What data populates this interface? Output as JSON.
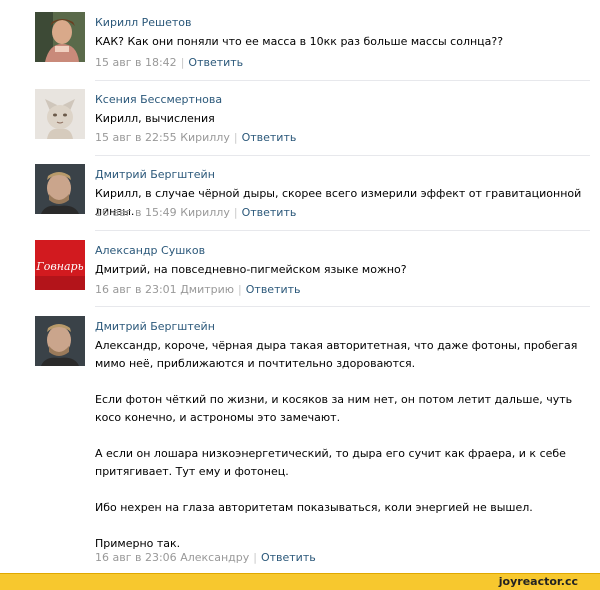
{
  "comments": [
    {
      "author": "Кирилл Решетов",
      "text": [
        "КАК? Как они поняли что ее масса в 10кк раз больше массы солнца??"
      ],
      "date": "15 авг в 18:42",
      "addressee": "",
      "reply": "Ответить"
    },
    {
      "author": "Ксения Бессмертнова",
      "text": [
        "Кирилл, вычисления"
      ],
      "date": "15 авг в 22:55",
      "addressee": "Кириллу",
      "reply": "Ответить"
    },
    {
      "author": "Дмитрий Бергштейн",
      "text": [
        "Кирилл, в случае чёрной дыры, скорее всего измерили эффект от гравитационной линзы."
      ],
      "date": "16 авг в 15:49",
      "addressee": "Кириллу",
      "reply": "Ответить"
    },
    {
      "author": "Александр Сушков",
      "avatar_text": "Говнарь",
      "text": [
        "Дмитрий, на повседневно-пигмейском языке можно?"
      ],
      "date": "16 авг в 23:01",
      "addressee": "Дмитрию",
      "reply": "Ответить"
    },
    {
      "author": "Дмитрий Бергштейн",
      "text": [
        "Александр, короче, чёрная дыра такая авторитетная, что даже фотоны, пробегая мимо неё, приближаются и почтительно здороваются.",
        "Если фотон чёткий по жизни, и косяков за ним нет, он потом летит дальше, чуть косо конечно, и астрономы это замечают.",
        "А если он лошара низкоэнергетический, то дыра его сучит как фраера, и к себе притягивает. Тут ему и фотонец.",
        "Ибо нехрен на глаза авторитетам показываться, коли энергией не вышел.",
        "Примерно так."
      ],
      "date": "16 авг в 23:06",
      "addressee": "Александру",
      "reply": "Ответить"
    }
  ],
  "footer": {
    "site": "joyreactor.cc"
  },
  "colors": {
    "link": "#2b587a",
    "meta": "#999999",
    "footer_bg": "#f7c82e"
  }
}
